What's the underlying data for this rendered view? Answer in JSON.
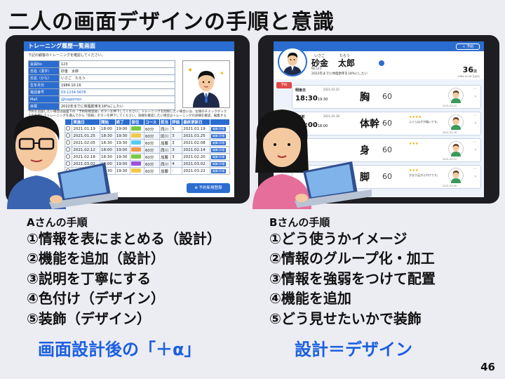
{
  "title": "二人の画面デザインの手順と意識",
  "screen_a": {
    "header": "トレーニング履歴一覧画面",
    "subtitle": "下記の顧客のトレーニングを確認してください。",
    "info": [
      {
        "k": "会員No",
        "v": "123"
      },
      {
        "k": "氏名（漢字）",
        "v": "砂金　太郎"
      },
      {
        "k": "氏名（かな）",
        "v": "いさご　たろう"
      },
      {
        "k": "生年月日",
        "v": "1984.10.16"
      },
      {
        "k": "電話番号",
        "v": "03-1234-5678"
      },
      {
        "k": "Mail",
        "v": "@isagomen"
      },
      {
        "k": "目標",
        "v": "2022年までに体脂肪率を18%にしたい"
      }
    ],
    "notes": "予約を追加したい場合は画面下の「予約新規登録」ボタンを押下してください。トレーニングを削除したい場合には、左側のチェックボックスを利用してトレーニングを選んでから「削除」ボタンを押下してください。詳細を確認したい場合はトレーニングの詳細を確認、編集することができます。",
    "columns": [
      "",
      "実施日",
      "開始",
      "終了",
      "部位",
      "コース",
      "担当",
      "評価",
      "最終更新日",
      ""
    ],
    "rows": [
      {
        "date": "2021.01.19",
        "start": "18:00",
        "end": "19:00",
        "tag": "#7ac943",
        "course": "60分",
        "staff": "西川",
        "score": "5",
        "updated": "2021.01.19"
      },
      {
        "date": "2021.01.25",
        "start": "18:30",
        "end": "19:30",
        "tag": "#f2c94c",
        "course": "60分",
        "staff": "田川",
        "score": "3",
        "updated": "2021.01.25"
      },
      {
        "date": "2021.02.05",
        "start": "18:30",
        "end": "19:30",
        "tag": "#56ccf2",
        "course": "60分",
        "staff": "加藤",
        "score": "3",
        "updated": "2021.02.08"
      },
      {
        "date": "2021.02.12",
        "start": "18:00",
        "end": "19:00",
        "tag": "#f2994a",
        "course": "60分",
        "staff": "西川",
        "score": "3",
        "updated": "2021.02.14"
      },
      {
        "date": "2021.02.18",
        "start": "18:30",
        "end": "19:30",
        "tag": "#7ac943",
        "course": "60分",
        "staff": "加藤",
        "score": "3",
        "updated": "2021.02.20"
      },
      {
        "date": "2021.03.02",
        "start": "18:00",
        "end": "19:00",
        "tag": "#9b51e0",
        "course": "60分",
        "staff": "西川",
        "score": "4",
        "updated": "2021.03.02"
      },
      {
        "date": "2021.03.25",
        "start": "18:30",
        "end": "19:30",
        "tag": "#f2c94c",
        "course": "60分",
        "staff": "加藤",
        "score": "-",
        "updated": "2021.03.22"
      }
    ],
    "row_button": "編集/詳細",
    "reserve_button": "予約新規登録"
  },
  "screen_b": {
    "book_button": "予約",
    "ruby_last": "いさご",
    "ruby_first": "たろう",
    "name_last": "砂金",
    "name_first": "太郎",
    "member_no": "No.123",
    "goal": "2022年までに体脂肪率を18%にしたい",
    "age": "36",
    "age_unit": "歳",
    "birth": "1984.10.16 生まれ",
    "reserve_tag": "予約",
    "cards": [
      {
        "day": "明後日",
        "date": "2021.03.25",
        "time": "18:30",
        "end": "19:30",
        "part": "胸",
        "min": "60",
        "stars": "",
        "comment": "",
        "fdate": "2021.03.22"
      },
      {
        "day": "2日前",
        "date": "2021.03.18",
        "time": "17:00",
        "end": "18:00",
        "part": "体幹",
        "min": "60",
        "stars": "★★★★",
        "comment": "ふくらはぎが痛いです。",
        "fdate": "2021.03.16"
      },
      {
        "day": "",
        "date": "",
        "time": "",
        "end": "",
        "part": "身",
        "min": "60",
        "stars": "★★★",
        "comment": "",
        "fdate": "2021.03.12"
      },
      {
        "day": "",
        "date": "",
        "time": "",
        "end": "",
        "part": "脚",
        "min": "60",
        "stars": "★★★",
        "comment": "かなり足がふやけです。",
        "fdate": "2021.03.09"
      }
    ]
  },
  "label_a": "Aさんの手順",
  "steps_a": [
    "①情報を表にまとめる（設計）",
    "②機能を追加（設計）",
    "③説明を丁寧にする",
    "④色付け（デザイン）",
    "⑤装飾（デザイン）"
  ],
  "slogan_a": "画面設計後の「＋α」",
  "label_b": "Bさんの手順",
  "steps_b": [
    "①どう使うかイメージ",
    "②情報のグループ化・加工",
    "③情報を強弱をつけて配置",
    "④機能を追加",
    "⑤どう見せたいかで装飾"
  ],
  "slogan_b": "設計＝デザイン",
  "page_number": "46",
  "colors": {
    "accent": "#2b6cd0",
    "slogan": "#1a5fe0",
    "background": "#ececf3"
  }
}
